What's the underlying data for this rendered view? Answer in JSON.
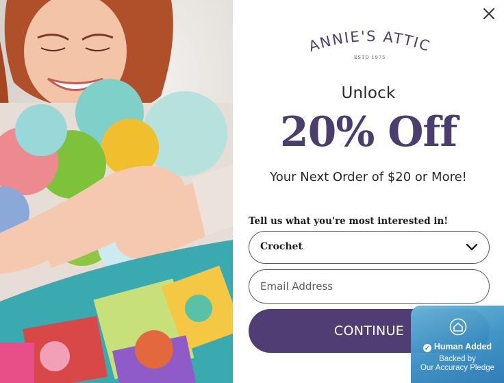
{
  "brand": {
    "name": "ANNIE'S ATTIC",
    "established": "ESTD 1975",
    "color": "#4b3d6d"
  },
  "offer": {
    "lead": "Unlock",
    "headline": "20% Off",
    "subline": "Your Next Order of $20 or More!"
  },
  "form": {
    "interest_prompt": "Tell us what you're most interested in!",
    "interest_selected": "Crochet",
    "email_placeholder": "Email Address",
    "continue_label": "CONTINUE"
  },
  "badge": {
    "title": "Human Added",
    "line1": "Backed by",
    "line2": "Our Accuracy Pledge"
  },
  "icons": {
    "close": "close-icon",
    "dropdown": "chevron-down-icon",
    "badge": "home-icon",
    "check": "check-icon"
  },
  "colors": {
    "accent": "#4f3d73",
    "badge_blue": "#3a8fc4"
  }
}
